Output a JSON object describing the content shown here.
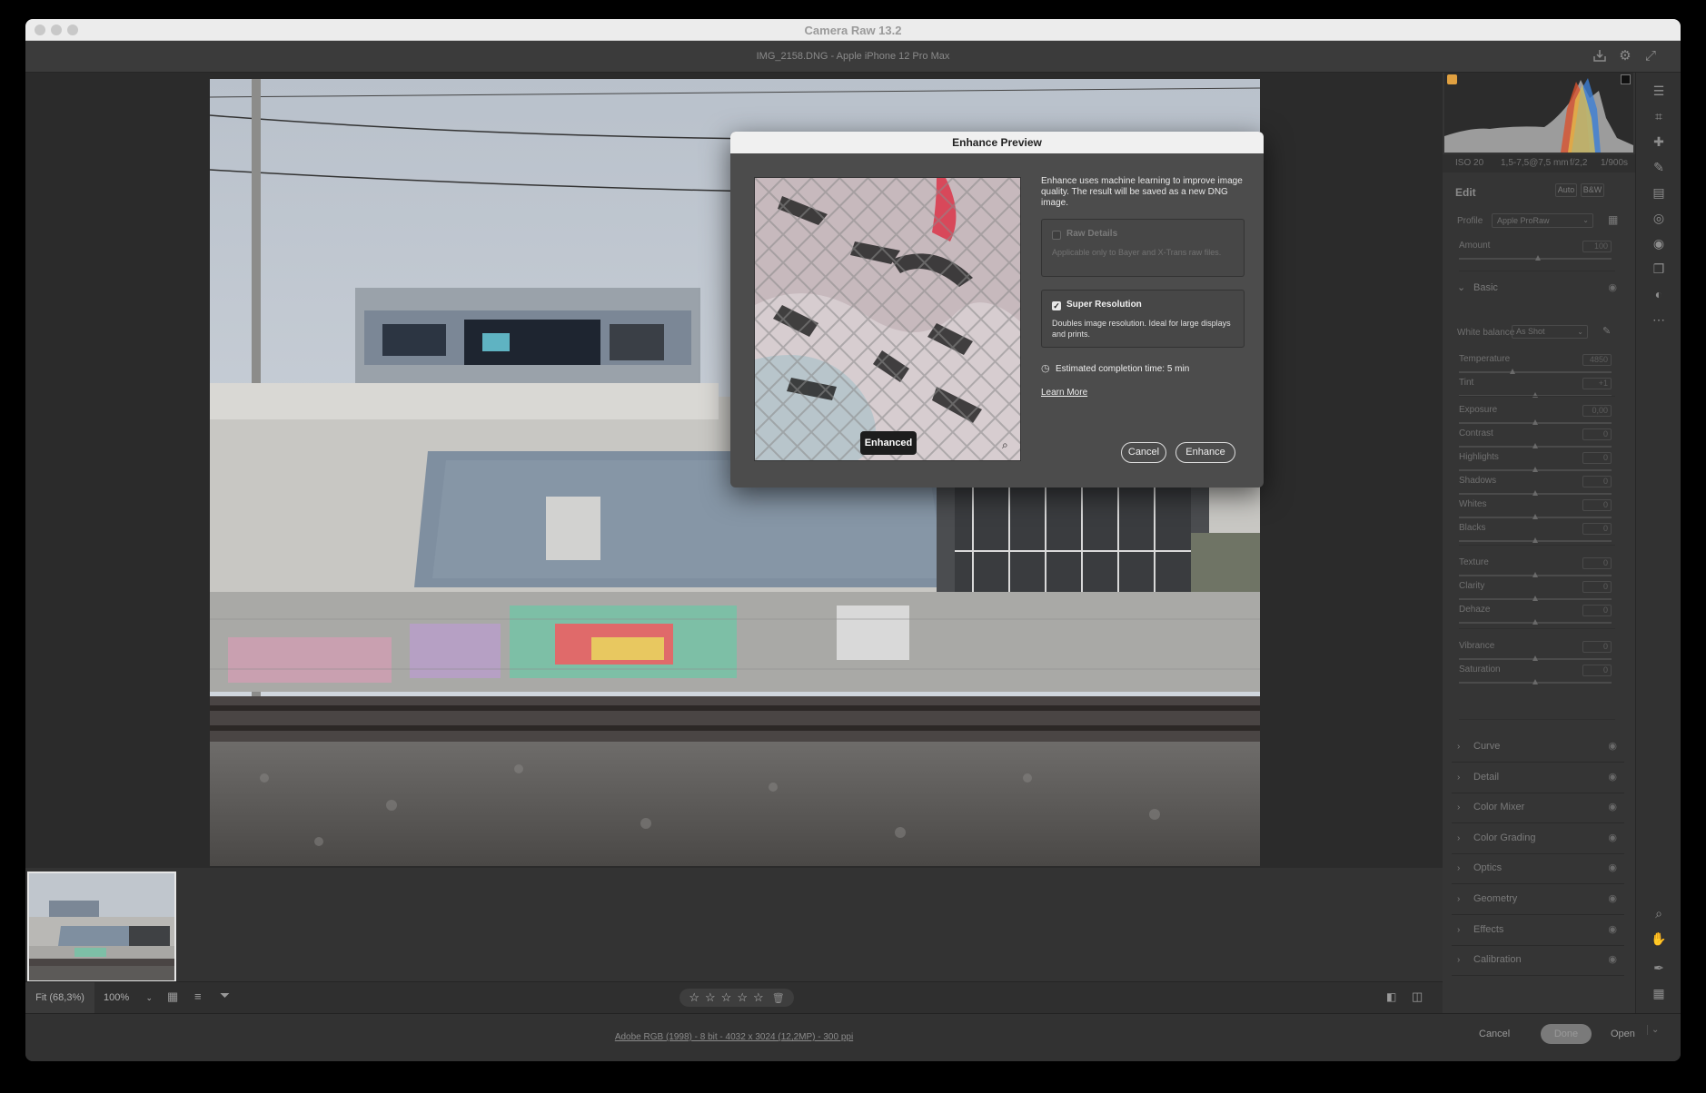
{
  "window": {
    "title": "Camera Raw 13.2"
  },
  "document": {
    "title": "IMG_2158.DNG  -  Apple iPhone 12 Pro Max"
  },
  "toolbar_icons": [
    "save-icon",
    "gear-icon",
    "fullscreen-icon"
  ],
  "histogram": {
    "iso": "ISO 20",
    "lens": "1,5-7,5@7,5 mm",
    "aperture": "f/2,2",
    "shutter": "1/900s"
  },
  "edit": {
    "title": "Edit",
    "auto_label": "Auto",
    "bw_label": "B&W",
    "profile_label": "Profile",
    "profile_value": "Apple ProRaw",
    "amount_label": "Amount",
    "amount_value": "100"
  },
  "basic": {
    "title": "Basic",
    "wb_label": "White balance",
    "wb_value": "As Shot",
    "sliders": [
      {
        "name": "Temperature",
        "value": "4850",
        "pos": 0.35
      },
      {
        "name": "Tint",
        "value": "+1",
        "pos": 0.5
      },
      {
        "name": "Exposure",
        "value": "0,00",
        "pos": 0.5
      },
      {
        "name": "Contrast",
        "value": "0",
        "pos": 0.5
      },
      {
        "name": "Highlights",
        "value": "0",
        "pos": 0.5
      },
      {
        "name": "Shadows",
        "value": "0",
        "pos": 0.5
      },
      {
        "name": "Whites",
        "value": "0",
        "pos": 0.5
      },
      {
        "name": "Blacks",
        "value": "0",
        "pos": 0.5
      },
      {
        "name": "Texture",
        "value": "0",
        "pos": 0.5
      },
      {
        "name": "Clarity",
        "value": "0",
        "pos": 0.5
      },
      {
        "name": "Dehaze",
        "value": "0",
        "pos": 0.5
      },
      {
        "name": "Vibrance",
        "value": "0",
        "pos": 0.5
      },
      {
        "name": "Saturation",
        "value": "0",
        "pos": 0.5
      }
    ]
  },
  "sections": [
    "Curve",
    "Detail",
    "Color Mixer",
    "Color Grading",
    "Optics",
    "Geometry",
    "Effects",
    "Calibration"
  ],
  "dialog": {
    "title": "Enhance Preview",
    "preview_tag": "Enhanced",
    "description": "Enhance uses machine learning to improve image quality. The result will be saved as a new DNG image.",
    "raw_details": {
      "title": "Raw Details",
      "desc": "Applicable only to Bayer and X-Trans raw files.",
      "checked": false
    },
    "super_resolution": {
      "title": "Super Resolution",
      "desc": "Doubles image resolution. Ideal for large displays and prints.",
      "checked": true
    },
    "estimate": "Estimated completion time: 5 min",
    "learn_more": "Learn More",
    "cancel": "Cancel",
    "enhance": "Enhance"
  },
  "bottom": {
    "fit_label": "Fit (68,3%)",
    "zoom_value": "100%",
    "stars": [
      "☆",
      "☆",
      "☆",
      "☆",
      "☆"
    ]
  },
  "status": {
    "info": "Adobe RGB (1998) - 8 bit - 4032 x 3024 (12,2MP) - 300 ppi",
    "cancel": "Cancel",
    "done": "Done",
    "open": "Open"
  }
}
